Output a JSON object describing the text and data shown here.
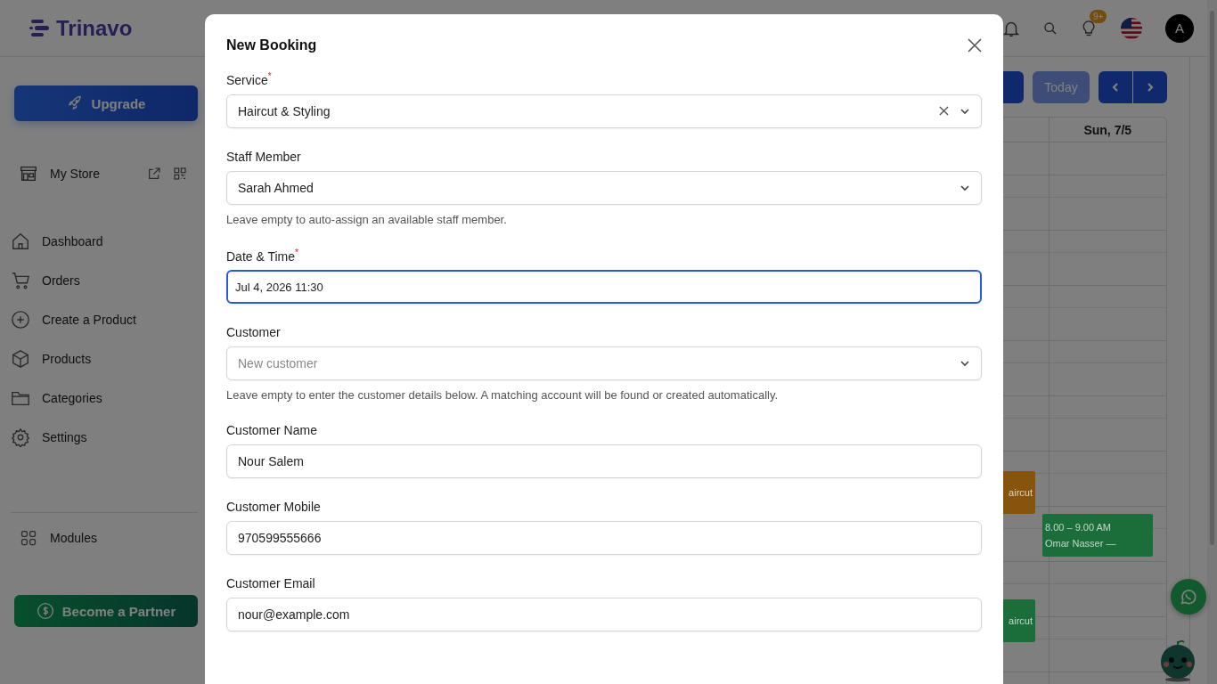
{
  "brand": {
    "name": "Trinavo"
  },
  "header": {
    "badge": "9+",
    "avatar": "A"
  },
  "sidebar": {
    "upgrade": "Upgrade",
    "store": "My Store",
    "items": [
      {
        "label": "Dashboard"
      },
      {
        "label": "Orders"
      },
      {
        "label": "Create a Product"
      },
      {
        "label": "Products"
      },
      {
        "label": "Categories"
      },
      {
        "label": "Settings"
      }
    ],
    "modules": "Modules",
    "partner": "Become a Partner"
  },
  "toolbar": {
    "today": "Today"
  },
  "calendar": {
    "columns": [
      {
        "events": [
          {
            "lines": [
              "aircut"
            ],
            "color": "#87540e"
          },
          {
            "lines": [
              "aircut"
            ],
            "color": "#1b6d3a"
          }
        ]
      },
      {
        "header": "Sun, 7/5",
        "events": [
          {
            "lines": [
              "8.00 – 9.00 AM",
              "Omar Nasser —"
            ],
            "color": "#1b6d3a"
          }
        ]
      }
    ]
  },
  "modal": {
    "title": "New Booking",
    "fields": [
      {
        "label": "Service",
        "required_mark": "*",
        "kind": "select",
        "value": "Haircut & Styling",
        "clearable": true,
        "focused": false
      },
      {
        "label": "Staff Member",
        "kind": "select",
        "value": "Sarah Ahmed",
        "clearable": false,
        "focused": false,
        "help": "Leave empty to auto-assign an available staff member."
      },
      {
        "label": "Date & Time",
        "required_mark": "*",
        "kind": "input",
        "value": "Jul 4, 2026 11:30",
        "focused": true
      },
      {
        "label": "Customer",
        "kind": "select",
        "placeholder": "New customer",
        "clearable": false,
        "focused": false,
        "help": "Leave empty to enter the customer details below. A matching account will be found or created automatically."
      },
      {
        "label": "Customer Name",
        "kind": "input",
        "value": "Nour Salem",
        "focused": false
      },
      {
        "label": "Customer Mobile",
        "kind": "input",
        "value": "970599555666",
        "focused": false
      },
      {
        "label": "Customer Email",
        "kind": "input",
        "value": "nour@example.com",
        "focused": false
      }
    ]
  }
}
